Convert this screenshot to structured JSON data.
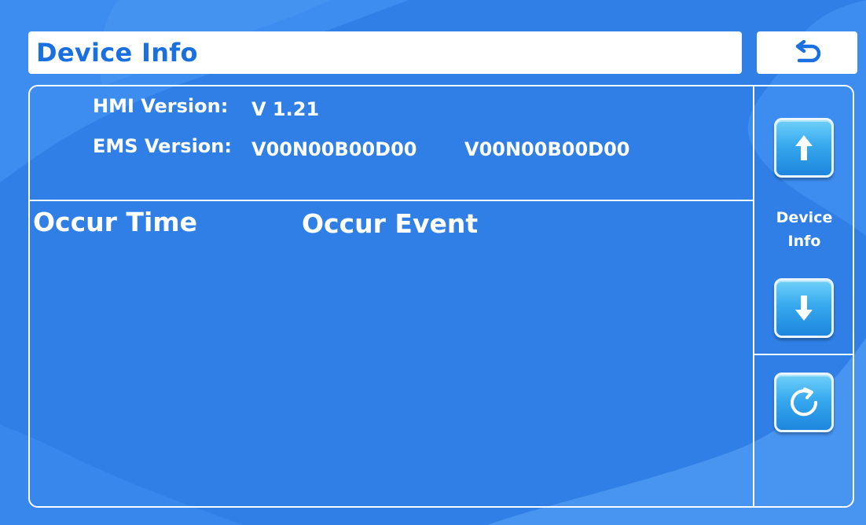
{
  "header": {
    "title": "Device Info",
    "back_icon": "return-arrow-icon"
  },
  "versions": {
    "hmi_label": "HMI Version:",
    "hmi_value": "V 1.21",
    "ems_label": "EMS Version:",
    "ems_value_1": "V00N00B00D00",
    "ems_value_2": "V00N00B00D00"
  },
  "log_table": {
    "columns": [
      "Occur Time",
      "Occur Event"
    ],
    "rows": []
  },
  "side_panel": {
    "label_line1": "Device",
    "label_line2": "Info",
    "up_icon": "arrow-up-icon",
    "down_icon": "arrow-down-icon",
    "refresh_icon": "refresh-icon"
  },
  "colors": {
    "background": "#2f7fe6",
    "accent": "#1a70e0",
    "button": "#37a9ee",
    "text": "#ffffff"
  }
}
